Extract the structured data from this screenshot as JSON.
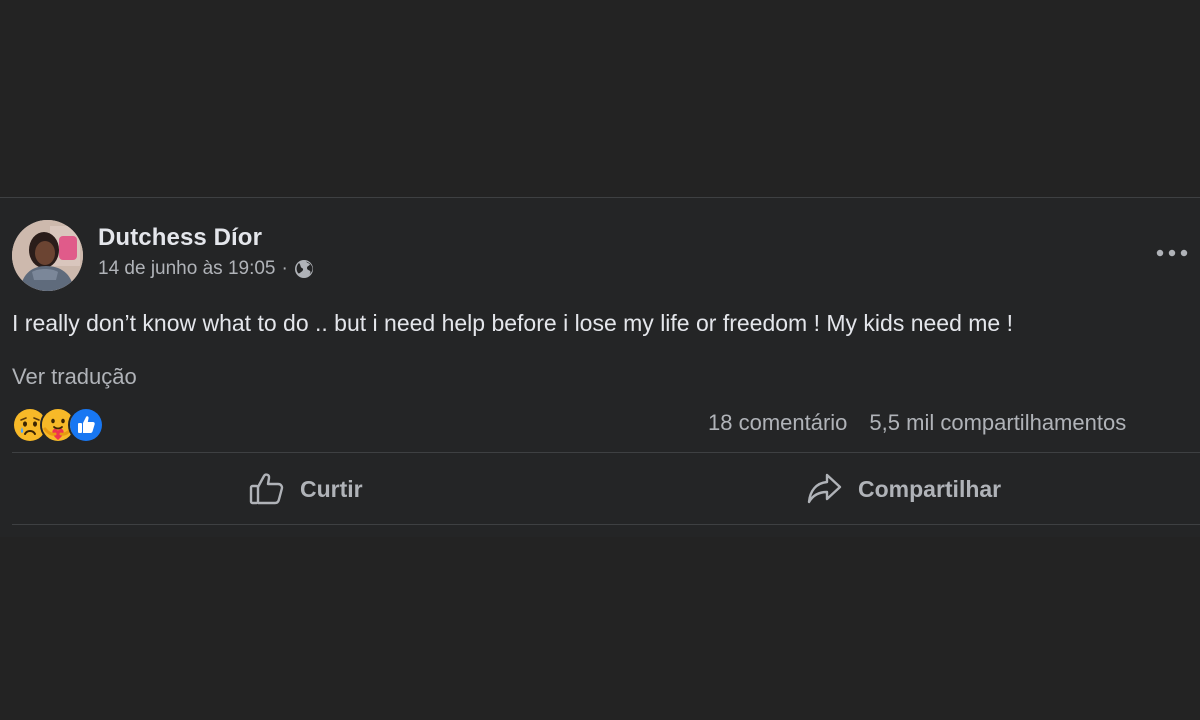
{
  "post": {
    "author": "Dutchess Díor",
    "date": "14 de junho às 19:05",
    "separator": "·",
    "audience_icon": "globe-icon",
    "text": "I really don’t know what to do .. but i need help before i lose my life or freedom ! My kids need me !",
    "translate_link": "Ver tradução",
    "reactions": [
      "sad-reaction-icon",
      "care-reaction-icon",
      "like-reaction-icon"
    ],
    "comments_count": "18 comentário",
    "shares_count": "5,5 mil compartilhamentos",
    "more_icon": "more-options-icon"
  },
  "actions": {
    "like_label": "Curtir",
    "share_label": "Compartilhar"
  },
  "colors": {
    "background": "#232323",
    "card": "#242526",
    "primary_text": "#e4e6eb",
    "secondary_text": "#b0b3b8",
    "divider": "#3e4042",
    "like_blue": "#1877f2",
    "reaction_yellow": "#f7b928"
  }
}
